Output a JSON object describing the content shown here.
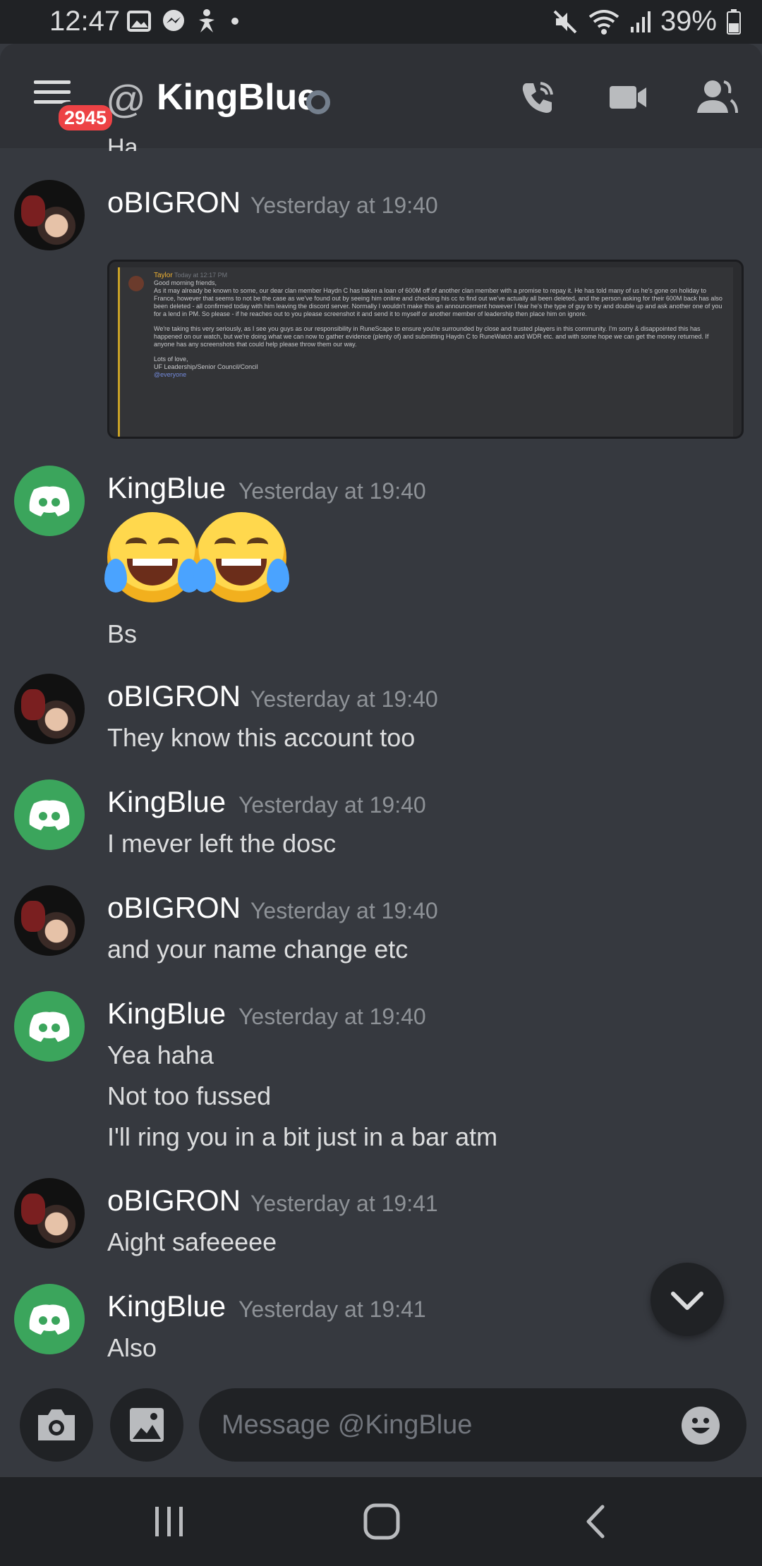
{
  "status_bar": {
    "time": "12:47",
    "battery": "39%"
  },
  "header": {
    "at_symbol": "@",
    "title": "KingBlue",
    "unread_badge": "2945",
    "presence": "offline"
  },
  "cutoff_text": "Ha",
  "embed": {
    "author": "Taylor",
    "timestamp": "Today at 12:17 PM",
    "line1": "Good morning friends,",
    "para1": "As it may already be known to some, our dear clan member Haydn C has taken a loan of 600M off of another clan member with a promise to repay it. He has told many of us he's gone on holiday to France, however that seems to not be the case as we've found out by seeing him online and checking his cc to find out we've actually all been deleted, and the person asking for their 600M back has also been deleted - all confirmed today with him leaving the discord server. Normally I wouldn't make this an announcement however I fear he's the type of guy to try and double up and ask another one of you for a lend in PM. So please - if he reaches out to you please screenshot it and send it to myself or another member of leadership then place him on ignore.",
    "para2": "We're taking this very seriously, as I see you guys as our responsibility in RuneScape to ensure you're surrounded by close and trusted players in this community. I'm sorry & disappointed this has happened on our watch, but we're doing what we can now to gather evidence (plenty of) and submitting Haydn C to RuneWatch and WDR etc. and with some hope we can get the money returned. If anyone has any screenshots that could help please throw them our way.",
    "signoff1": "Lots of love,",
    "signoff2": "UF Leadership/Senior Council/Concil",
    "mention": "@everyone"
  },
  "messages": [
    {
      "author": "oBIGRON",
      "time": "Yesterday at 19:40",
      "lines": []
    },
    {
      "author": "KingBlue",
      "time": "Yesterday at 19:40",
      "emoji": "joy x2",
      "lines": [
        "Bs"
      ]
    },
    {
      "author": "oBIGRON",
      "time": "Yesterday at 19:40",
      "lines": [
        "They know this account too"
      ]
    },
    {
      "author": "KingBlue",
      "time": "Yesterday at 19:40",
      "lines": [
        "I mever left the dosc"
      ]
    },
    {
      "author": "oBIGRON",
      "time": "Yesterday at 19:40",
      "lines": [
        "and your name change etc"
      ]
    },
    {
      "author": "KingBlue",
      "time": "Yesterday at 19:40",
      "lines": [
        "Yea haha",
        "Not too fussed",
        "I'll ring you in a bit just in a bar atm"
      ]
    },
    {
      "author": "oBIGRON",
      "time": "Yesterday at 19:41",
      "lines": [
        "Aight safeeeee"
      ]
    },
    {
      "author": "KingBlue",
      "time": "Yesterday at 19:41",
      "lines": [
        "Also"
      ]
    }
  ],
  "composer": {
    "placeholder": "Message @KingBlue"
  },
  "icons": {
    "menu": "hamburger-icon",
    "call": "phone-call-icon",
    "video": "video-camera-icon",
    "members": "member-list-icon",
    "camera": "camera-icon",
    "gallery": "image-icon",
    "emoji": "emoji-icon",
    "jump": "chevron-down-icon"
  },
  "colors": {
    "background": "#36393f",
    "header": "#2f3136",
    "badge": "#ed4245",
    "discord_green": "#3ba55c"
  }
}
